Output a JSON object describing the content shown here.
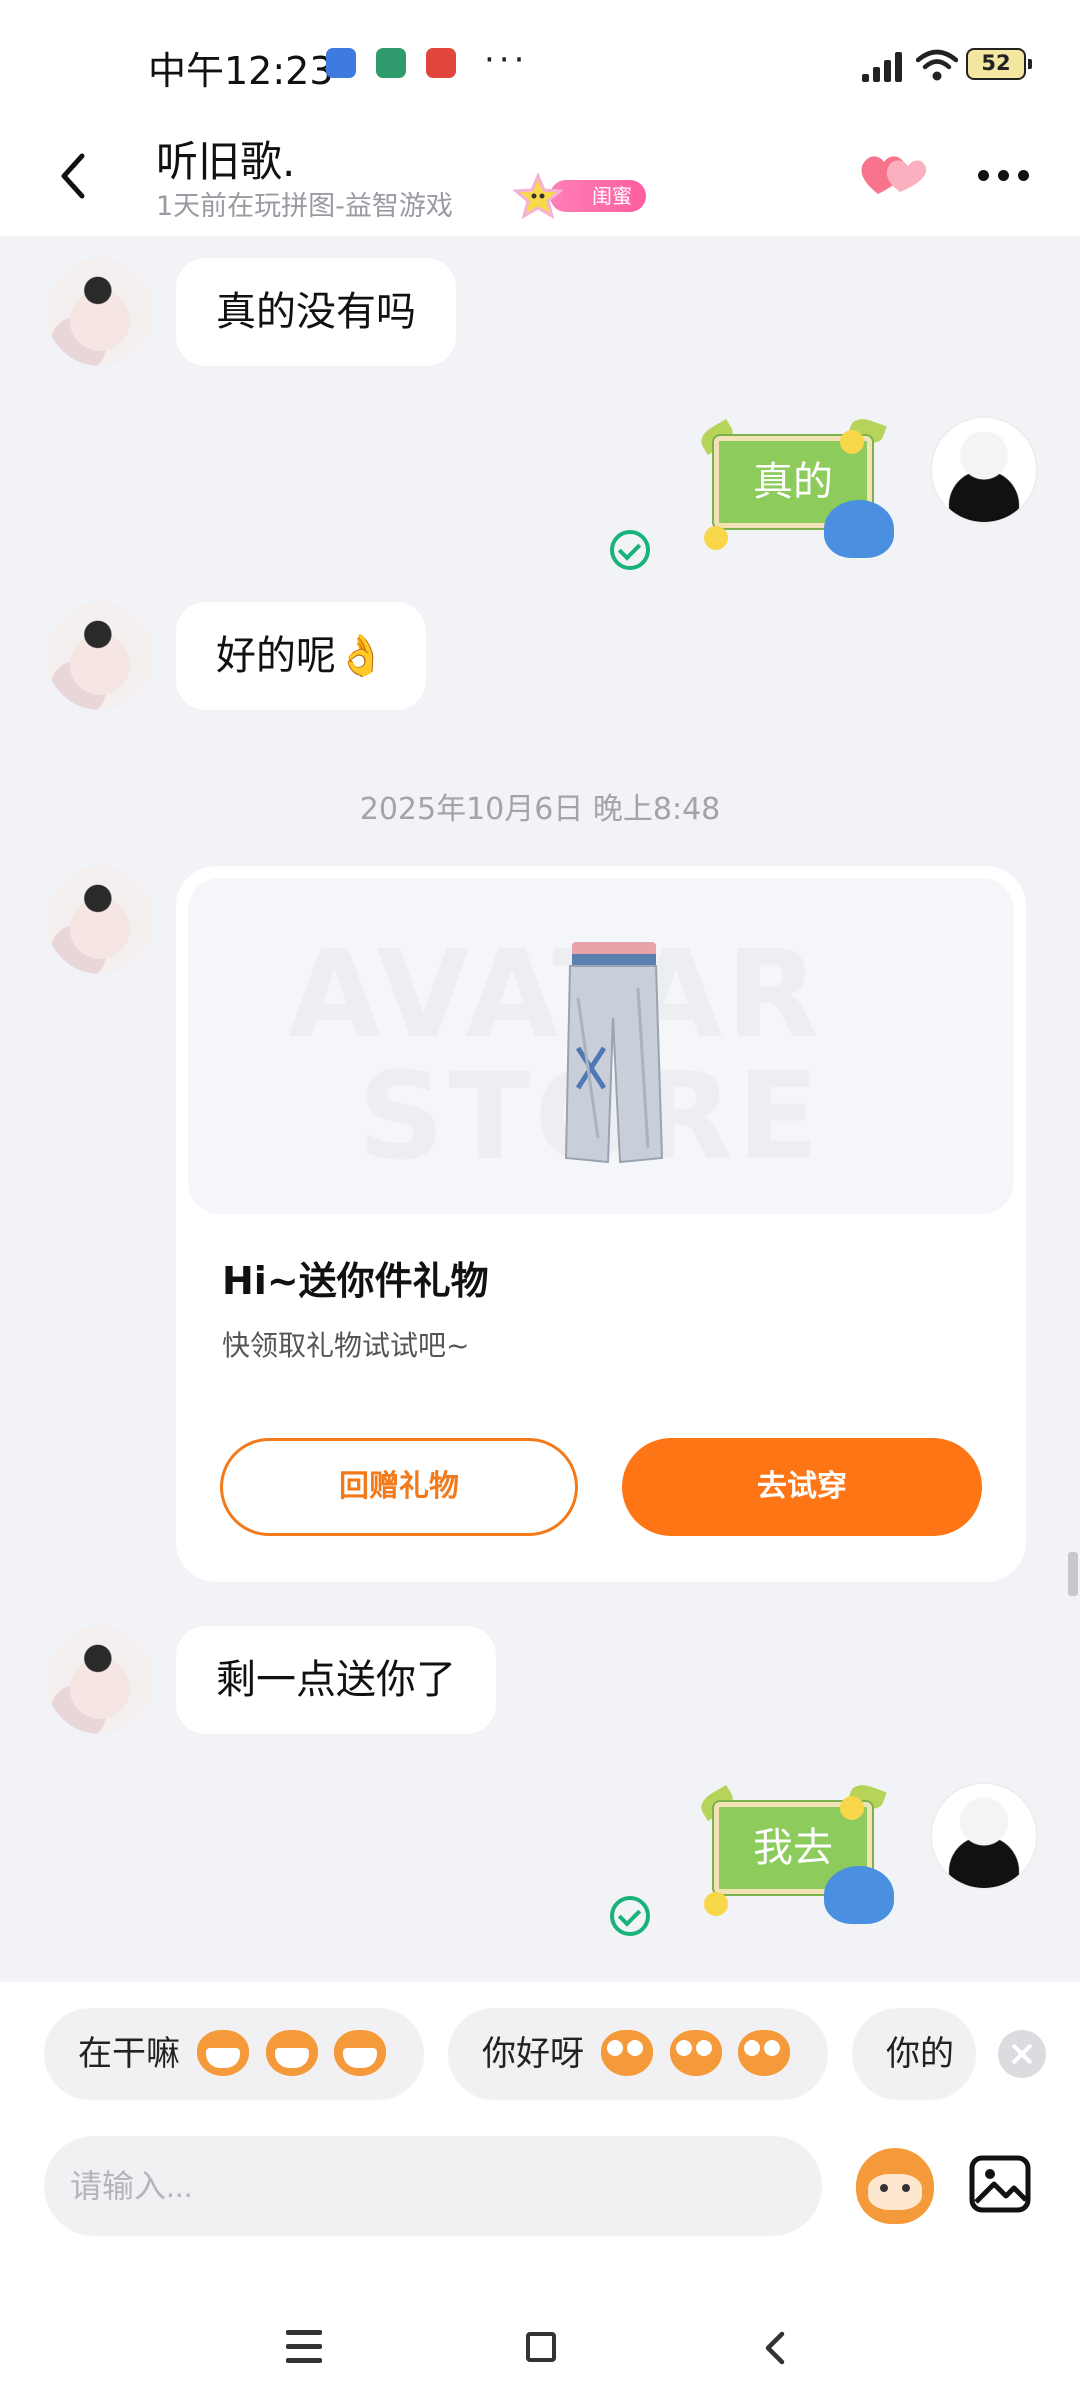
{
  "status_bar": {
    "time": "中午12:23",
    "more": "···",
    "battery": "52"
  },
  "header": {
    "name": "听旧歌.",
    "status": "1天前在玩拼图-益智游戏",
    "friend_badge": "闺蜜"
  },
  "messages": [
    {
      "side": "left",
      "type": "text",
      "text": "真的没有吗"
    },
    {
      "side": "right",
      "type": "sticker",
      "text": "真的",
      "read": true
    },
    {
      "side": "left",
      "type": "text",
      "text": "好的呢👌"
    },
    {
      "type": "timestamp",
      "text": "2025年10月6日 晚上8:48"
    },
    {
      "side": "left",
      "type": "gift",
      "title": "Hi~送你件礼物",
      "subtitle": "快领取礼物试试吧~",
      "return_button": "回赠礼物",
      "tryon_button": "去试穿",
      "watermark_top": "AVATAR",
      "watermark_bottom": "STORE"
    },
    {
      "side": "left",
      "type": "text",
      "text": "剩一点送你了"
    },
    {
      "side": "right",
      "type": "sticker",
      "text": "我去",
      "read": true
    }
  ],
  "quick_replies": [
    {
      "text": "在干嘛",
      "emoji": [
        "grin-face-icon",
        "grin-face-icon",
        "grin-face-icon"
      ]
    },
    {
      "text": "你好呀",
      "emoji": [
        "wow-face-icon",
        "wow-face-icon",
        "wow-face-icon"
      ]
    },
    {
      "text": "你的",
      "emoji": []
    }
  ],
  "input": {
    "placeholder": "请输入..."
  },
  "colors": {
    "accent_orange": "#fd7515",
    "read_green": "#19b27a",
    "badge_pink": "#ff6aa6",
    "chat_background": "#f2f3f7"
  }
}
